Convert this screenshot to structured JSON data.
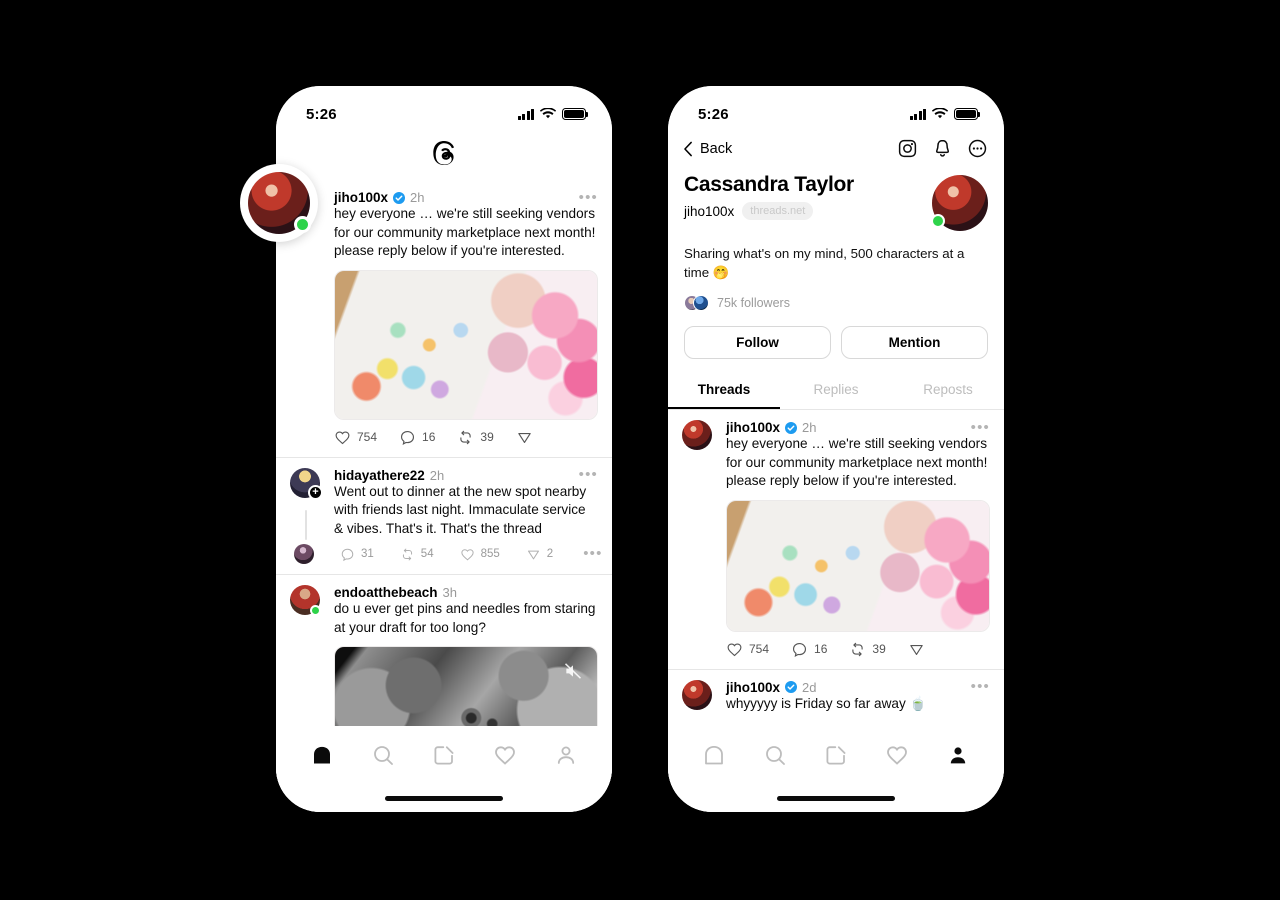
{
  "background_color": "#000000",
  "accent": {
    "verified_blue": "#1d9bf0",
    "online_green": "#2ed34a",
    "muted_text": "#999999"
  },
  "left_phone": {
    "status_bar": {
      "time": "5:26",
      "signal_icon": "cellular-bars-icon",
      "wifi_icon": "wifi-icon",
      "battery_icon": "battery-full-icon"
    },
    "app_logo": "threads-logo-icon",
    "overlay_avatar": {
      "name": "cassandra-avatar-overlay",
      "status": "online"
    },
    "feed": [
      {
        "username": "jiho100x",
        "verified": true,
        "time": "2h",
        "text": "hey everyone … we're still seeking vendors for our community marketplace next month! please reply below if you're interested.",
        "media": "stickers-photo",
        "actions": [
          {
            "icon": "heart-icon",
            "count": "754"
          },
          {
            "icon": "comment-icon",
            "count": "16"
          },
          {
            "icon": "repost-icon",
            "count": "39"
          },
          {
            "icon": "share-icon",
            "count": ""
          }
        ]
      },
      {
        "username": "hidayathere22",
        "verified": false,
        "time": "2h",
        "text": "Went out to dinner at the new spot nearby with friends last night. Immaculate service & vibes. That's it. That's the thread",
        "media": null,
        "actions": [
          {
            "icon": "comment-icon",
            "count": "31"
          },
          {
            "icon": "repost-icon",
            "count": "54"
          },
          {
            "icon": "heart-icon",
            "count": "855"
          },
          {
            "icon": "share-icon",
            "count": "2"
          }
        ],
        "more_icon": "more-dots-icon"
      },
      {
        "username": "endoatthebeach",
        "verified": false,
        "time": "3h",
        "text": "do u ever get pins and needles from staring at your draft for too long?",
        "media": "moon-video",
        "media_muted_icon": "speaker-muted-icon",
        "actions": []
      }
    ],
    "tabbar": [
      {
        "name": "home",
        "icon": "home-icon",
        "active": true
      },
      {
        "name": "search",
        "icon": "search-icon",
        "active": false
      },
      {
        "name": "compose",
        "icon": "compose-icon",
        "active": false
      },
      {
        "name": "activity",
        "icon": "heart-icon",
        "active": false
      },
      {
        "name": "profile",
        "icon": "person-icon",
        "active": false
      }
    ]
  },
  "right_phone": {
    "status_bar": {
      "time": "5:26",
      "signal_icon": "cellular-bars-icon",
      "wifi_icon": "wifi-icon",
      "battery_icon": "battery-full-icon"
    },
    "topnav": {
      "back_label": "Back",
      "back_icon": "chevron-left-icon",
      "icons": [
        {
          "name": "instagram-icon"
        },
        {
          "name": "bell-icon"
        },
        {
          "name": "more-circle-icon"
        }
      ]
    },
    "profile": {
      "display_name": "Cassandra Taylor",
      "handle": "jiho100x",
      "domain_pill": "threads.net",
      "bio": "Sharing what's on my mind, 500 characters at a time 🤭",
      "followers": "75k followers",
      "avatar_status": "online",
      "buttons": [
        {
          "label": "Follow",
          "name": "follow-button"
        },
        {
          "label": "Mention",
          "name": "mention-button"
        }
      ],
      "tabs": [
        {
          "label": "Threads",
          "active": true
        },
        {
          "label": "Replies",
          "active": false
        },
        {
          "label": "Reposts",
          "active": false
        }
      ]
    },
    "feed": [
      {
        "username": "jiho100x",
        "verified": true,
        "time": "2h",
        "text": "hey everyone … we're still seeking vendors for our community marketplace next month! please reply below if you're interested.",
        "media": "stickers-photo",
        "actions": [
          {
            "icon": "heart-icon",
            "count": "754"
          },
          {
            "icon": "comment-icon",
            "count": "16"
          },
          {
            "icon": "repost-icon",
            "count": "39"
          },
          {
            "icon": "share-icon",
            "count": ""
          }
        ]
      },
      {
        "username": "jiho100x",
        "verified": true,
        "time": "2d",
        "text": "whyyyyy is Friday so far away 🍵",
        "media": null,
        "actions": []
      }
    ],
    "tabbar": [
      {
        "name": "home",
        "icon": "home-icon",
        "active": false
      },
      {
        "name": "search",
        "icon": "search-icon",
        "active": false
      },
      {
        "name": "compose",
        "icon": "compose-icon",
        "active": false
      },
      {
        "name": "activity",
        "icon": "heart-icon",
        "active": false
      },
      {
        "name": "profile",
        "icon": "person-icon",
        "active": true
      }
    ]
  }
}
